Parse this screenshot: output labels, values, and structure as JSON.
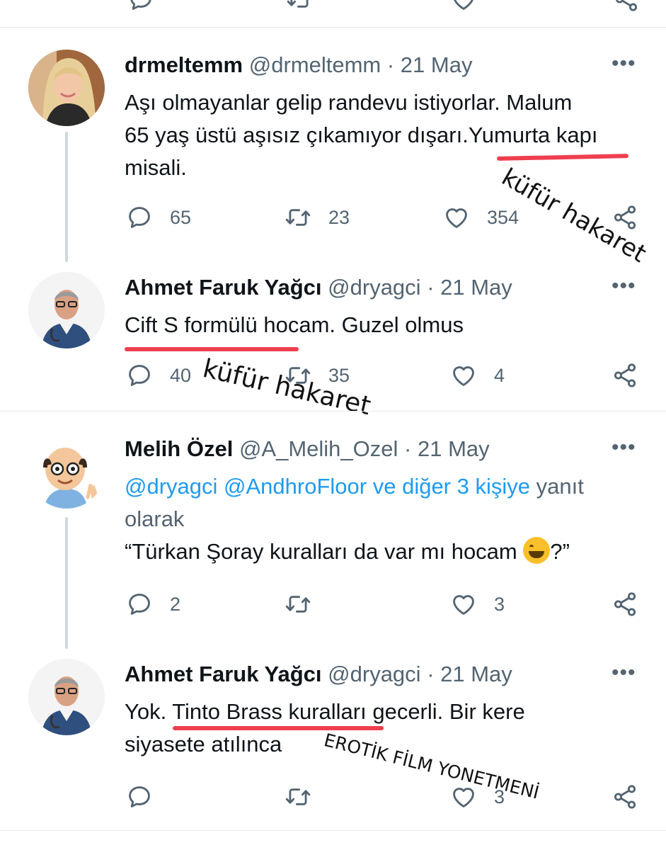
{
  "tweets": [
    {
      "name": "drmeltemm",
      "handle": "@drmeltemm",
      "date": "21 May",
      "text_lines": [
        "Aşı olmayanlar gelip randevu istiyorlar. Malum",
        "65 yaş üstü aşısız çıkamıyor dışarı.Yumurta kapı",
        "misali."
      ],
      "replies": "65",
      "retweets": "23",
      "likes": "354"
    },
    {
      "name": "Ahmet Faruk Yağcı",
      "handle": "@dryagci",
      "date": "21 May",
      "text_lines": [
        "Cift S formülü  hocam. Guzel olmus"
      ],
      "replies": "40",
      "retweets": "35",
      "likes": "4"
    },
    {
      "name": "Melih Özel",
      "handle": "@A_Melih_Ozel",
      "date": "21 May",
      "reply_to": {
        "mention1": "@dryagci",
        "mention2": "@AndhroFloor",
        "others": "ve diğer 3 kişiye",
        "suffix": "yanıt",
        "line2": "olarak"
      },
      "text": "“Türkan Şoray kuralları da var mı hocam",
      "text_end": "?”",
      "emoji": "grinning-face-emoji",
      "replies": "2",
      "likes": "3"
    },
    {
      "name": "Ahmet Faruk Yağcı",
      "handle": "@dryagci",
      "date": "21 May",
      "text_lines": [
        "Yok. Tinto Brass kuralları gecerli. Bir kere",
        "siyasete atılınca"
      ],
      "likes": "3"
    }
  ],
  "separator": "·",
  "more_label": "•••",
  "annotations": {
    "a1": "küfür hakaret",
    "a2": "küfür hakaret",
    "a3": "EROTİK FİLM YONETMENİ"
  },
  "colors": {
    "accent": "#1d9bf0",
    "highlight_underline": "#ef3f4f",
    "secondary_text": "#536471"
  },
  "icons": [
    "reply-icon",
    "retweet-icon",
    "like-icon",
    "share-icon",
    "more-icon"
  ]
}
